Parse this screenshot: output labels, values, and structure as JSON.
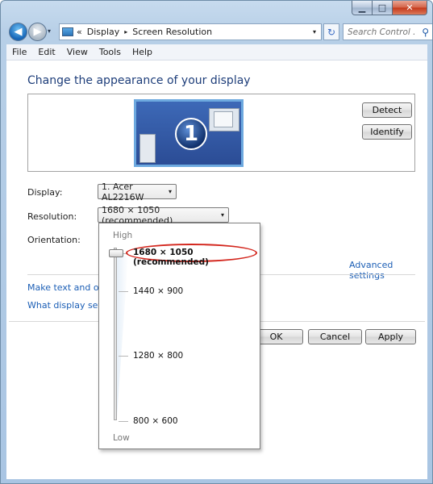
{
  "window": {
    "caption_buttons": {
      "minimize": "▁",
      "maximize": "□",
      "close": "✕"
    }
  },
  "nav": {
    "back": "◀",
    "forward": "▶",
    "history_arrow": "▾",
    "breadcrumb_chevrons": "«",
    "crumbs": [
      "Display",
      "Screen Resolution"
    ],
    "crumb_separator": "▸",
    "address_dropdown": "▾",
    "refresh_glyph": "↻",
    "search_placeholder": "Search Control ...",
    "search_glyph": "⚲"
  },
  "menu": [
    "File",
    "Edit",
    "View",
    "Tools",
    "Help"
  ],
  "main": {
    "title": "Change the appearance of your display",
    "monitor_number": "1",
    "detect_label": "Detect",
    "identify_label": "Identify",
    "display_label": "Display:",
    "display_value": "1. Acer AL2216W",
    "resolution_label": "Resolution:",
    "resolution_value": "1680 × 1050 (recommended)",
    "orientation_label": "Orientation:",
    "advanced_link": "Advanced settings",
    "link1": "Make text and other",
    "link2": "What display setting",
    "ok_label": "OK",
    "cancel_label": "Cancel",
    "apply_label": "Apply",
    "combo_arrow": "▾"
  },
  "resolution_dropdown": {
    "high_label": "High",
    "low_label": "Low",
    "options": [
      "1680 × 1050 (recommended)",
      "1440 × 900",
      "1280 × 800",
      "800 × 600"
    ],
    "selected": "1680 × 1050 (recommended)",
    "slider_level": 1.0
  },
  "colors": {
    "title_blue": "#1e3e7a",
    "link_blue": "#1b5eb5",
    "highlight_ring": "#d3261d"
  },
  "icons": [
    "back-arrow-icon",
    "forward-arrow-icon",
    "control-panel-icon",
    "refresh-icon",
    "search-icon",
    "monitor-icon",
    "dropdown-arrow-icon"
  ]
}
